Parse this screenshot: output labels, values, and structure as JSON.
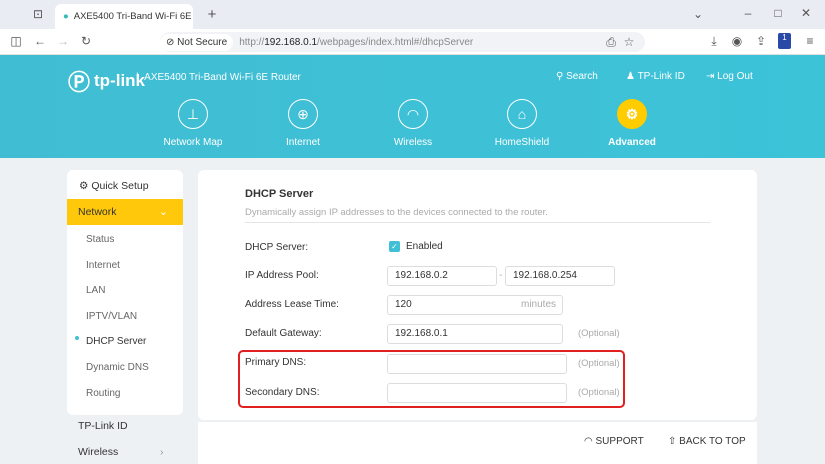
{
  "browser": {
    "tab_title": "AXE5400 Tri-Band Wi-Fi 6E Router",
    "not_secure": "Not Secure",
    "url_prefix": "http://",
    "url_host": "192.168.0.1",
    "url_path": "/webpages/index.html#/dhcpServer",
    "ext_badge": "1"
  },
  "header": {
    "brand": "tp-link",
    "product": "AXE5400 Tri-Band Wi-Fi 6E Router",
    "search": "Search",
    "tplink_id": "TP-Link ID",
    "logout": "Log Out",
    "nav": [
      {
        "label": "Network Map"
      },
      {
        "label": "Internet"
      },
      {
        "label": "Wireless"
      },
      {
        "label": "HomeShield"
      },
      {
        "label": "Advanced"
      }
    ]
  },
  "sidebar": {
    "quick_setup": "Quick Setup",
    "network": "Network",
    "items": [
      "Status",
      "Internet",
      "LAN",
      "IPTV/VLAN",
      "DHCP Server",
      "Dynamic DNS",
      "Routing"
    ],
    "tplink_id": "TP-Link ID",
    "wireless": "Wireless"
  },
  "main": {
    "title": "DHCP Server",
    "subtitle": "Dynamically assign IP addresses to the devices connected to the router.",
    "dhcp_label": "DHCP Server:",
    "dhcp_value": "Enabled",
    "pool_label": "IP Address Pool:",
    "pool_start": "192.168.0.2",
    "pool_sep": "-",
    "pool_end": "192.168.0.254",
    "lease_label": "Address Lease Time:",
    "lease_value": "120",
    "lease_unit": "minutes",
    "gateway_label": "Default Gateway:",
    "gateway_value": "192.168.0.1",
    "primary_label": "Primary DNS:",
    "secondary_label": "Secondary DNS:",
    "optional": "(Optional)"
  },
  "footer": {
    "support": "SUPPORT",
    "back_to_top": "BACK TO TOP"
  },
  "colors": {
    "accent": "#3fc0d6",
    "active": "#ffcc00",
    "highlight": "#e02020"
  }
}
